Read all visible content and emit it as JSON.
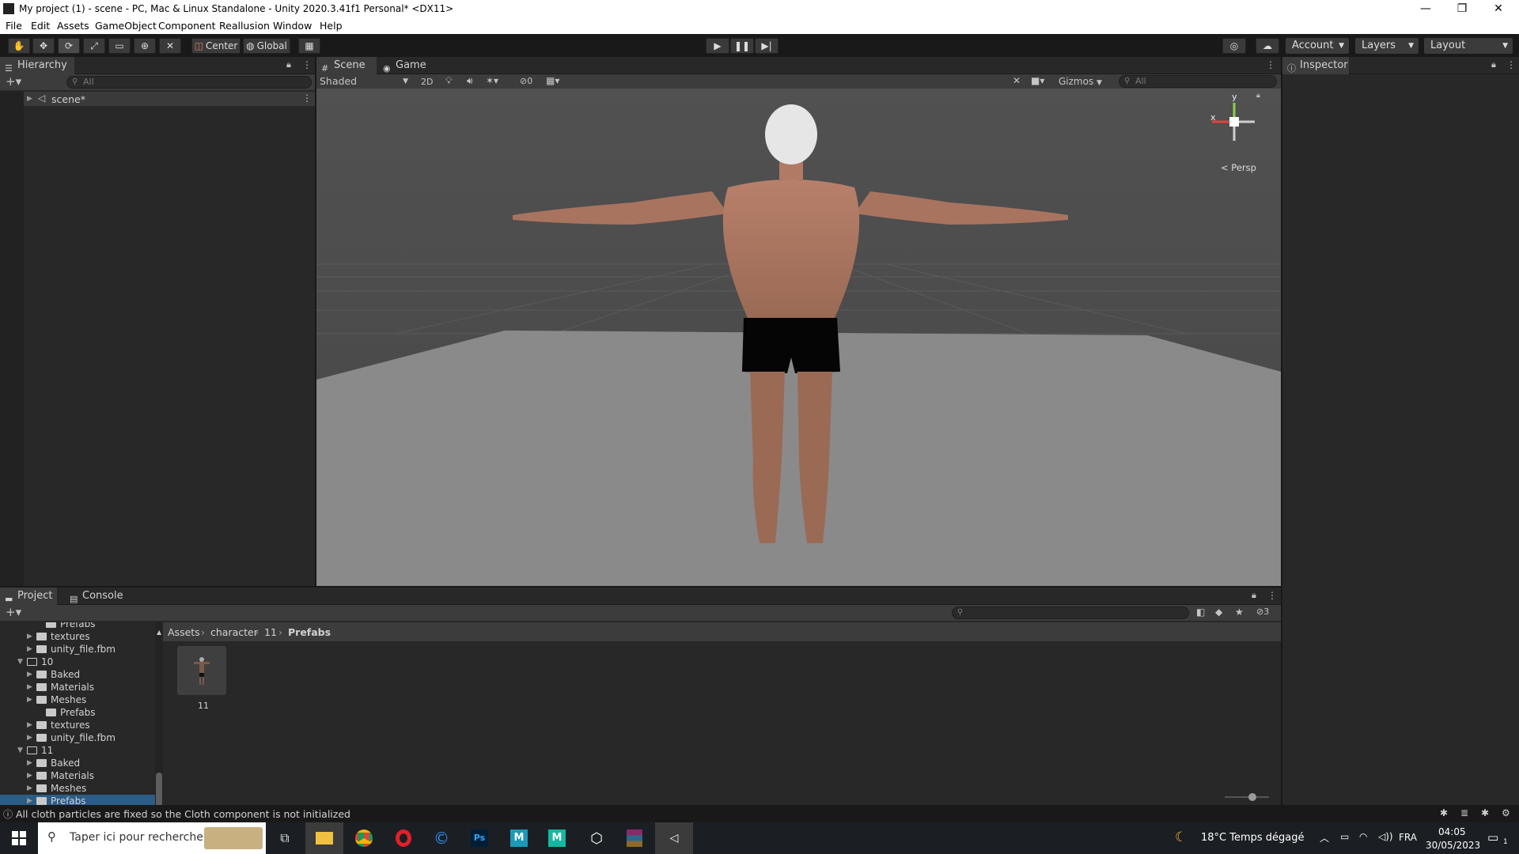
{
  "window": {
    "title": "My project (1) - scene - PC, Mac & Linux Standalone - Unity 2020.3.41f1 Personal* <DX11>",
    "minimize": "—",
    "maximize": "❐",
    "close": "✕"
  },
  "menu": [
    "File",
    "Edit",
    "Assets",
    "GameObject",
    "Component",
    "Reallusion",
    "Window",
    "Help"
  ],
  "toolbar": {
    "pivot": "Center",
    "space": "Global",
    "account": "Account",
    "layers": "Layers",
    "layout": "Layout"
  },
  "hierarchy": {
    "tab": "Hierarchy",
    "search_placeholder": "All",
    "scene_name": "scene*"
  },
  "scene_view": {
    "tab_scene": "Scene",
    "tab_game": "Game",
    "draw_mode": "Shaded",
    "mode_2d": "2D",
    "hidden_count": "0",
    "gizmos": "Gizmos",
    "search_placeholder": "All",
    "gizmo_y": "y",
    "gizmo_x": "x",
    "projection": "Persp"
  },
  "inspector": {
    "tab": "Inspector"
  },
  "project": {
    "tab_project": "Project",
    "tab_console": "Console",
    "hidden_count": "3",
    "breadcrumb": [
      "Assets",
      "character",
      "11",
      "Prefabs"
    ],
    "tree": [
      {
        "label": "Prefabs",
        "expand": "",
        "open": false
      },
      {
        "label": "textures",
        "expand": "▶",
        "open": false
      },
      {
        "label": "unity_file.fbm",
        "expand": "▶",
        "open": false
      },
      {
        "label": "10",
        "expand": "▼",
        "open": true
      },
      {
        "label": "Baked",
        "expand": "▶",
        "open": false
      },
      {
        "label": "Materials",
        "expand": "▶",
        "open": false
      },
      {
        "label": "Meshes",
        "expand": "▶",
        "open": false
      },
      {
        "label": "Prefabs",
        "expand": "",
        "open": false
      },
      {
        "label": "textures",
        "expand": "▶",
        "open": false
      },
      {
        "label": "unity_file.fbm",
        "expand": "▶",
        "open": false
      },
      {
        "label": "11",
        "expand": "▼",
        "open": true
      },
      {
        "label": "Baked",
        "expand": "▶",
        "open": false
      },
      {
        "label": "Materials",
        "expand": "▶",
        "open": false
      },
      {
        "label": "Meshes",
        "expand": "▶",
        "open": false
      },
      {
        "label": "Prefabs",
        "expand": "▶",
        "open": false
      }
    ],
    "asset_name": "11"
  },
  "status": {
    "message": "All cloth particles are fixed so the Cloth component is not initialized"
  },
  "taskbar": {
    "search_placeholder": "Taper ici pour rechercher",
    "weather": "18°C  Temps dégagé",
    "language": "FRA",
    "time": "04:05",
    "date": "30/05/2023",
    "notification_count": "1"
  },
  "colors": {
    "editor_bg": "#191919",
    "panel_bg": "#282828",
    "tab_active": "#3c3c3c",
    "selection": "#2c5d87",
    "scene_sky": "#505050",
    "scene_ground": "#8a8a8a"
  }
}
